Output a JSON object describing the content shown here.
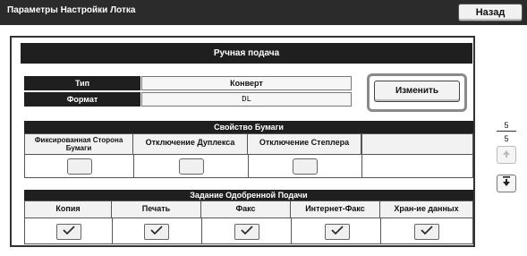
{
  "header": {
    "title": "Параметры Настройки Лотка",
    "back_label": "Назад"
  },
  "manual_feed": {
    "title": "Ручная подача"
  },
  "type_size": {
    "type_label": "Тип",
    "type_value": "Конверт",
    "size_label": "Формат",
    "size_value": "DL",
    "change_label": "Изменить"
  },
  "paper_property": {
    "title": "Свойство Бумаги",
    "columns": [
      "Фиксированная Сторона Бумаги",
      "Отключение Дуплекса",
      "Отключение Степлера"
    ]
  },
  "approved_jobs": {
    "title": "Задание Одобренной Подачи",
    "columns": [
      "Копия",
      "Печать",
      "Факс",
      "Интернет-Факс",
      "Хран-ие данных"
    ]
  },
  "pager": {
    "current": "5",
    "total": "5"
  },
  "icons": {
    "up": "arrow-up-icon",
    "down": "arrow-down-icon",
    "check": "checkmark-icon"
  }
}
